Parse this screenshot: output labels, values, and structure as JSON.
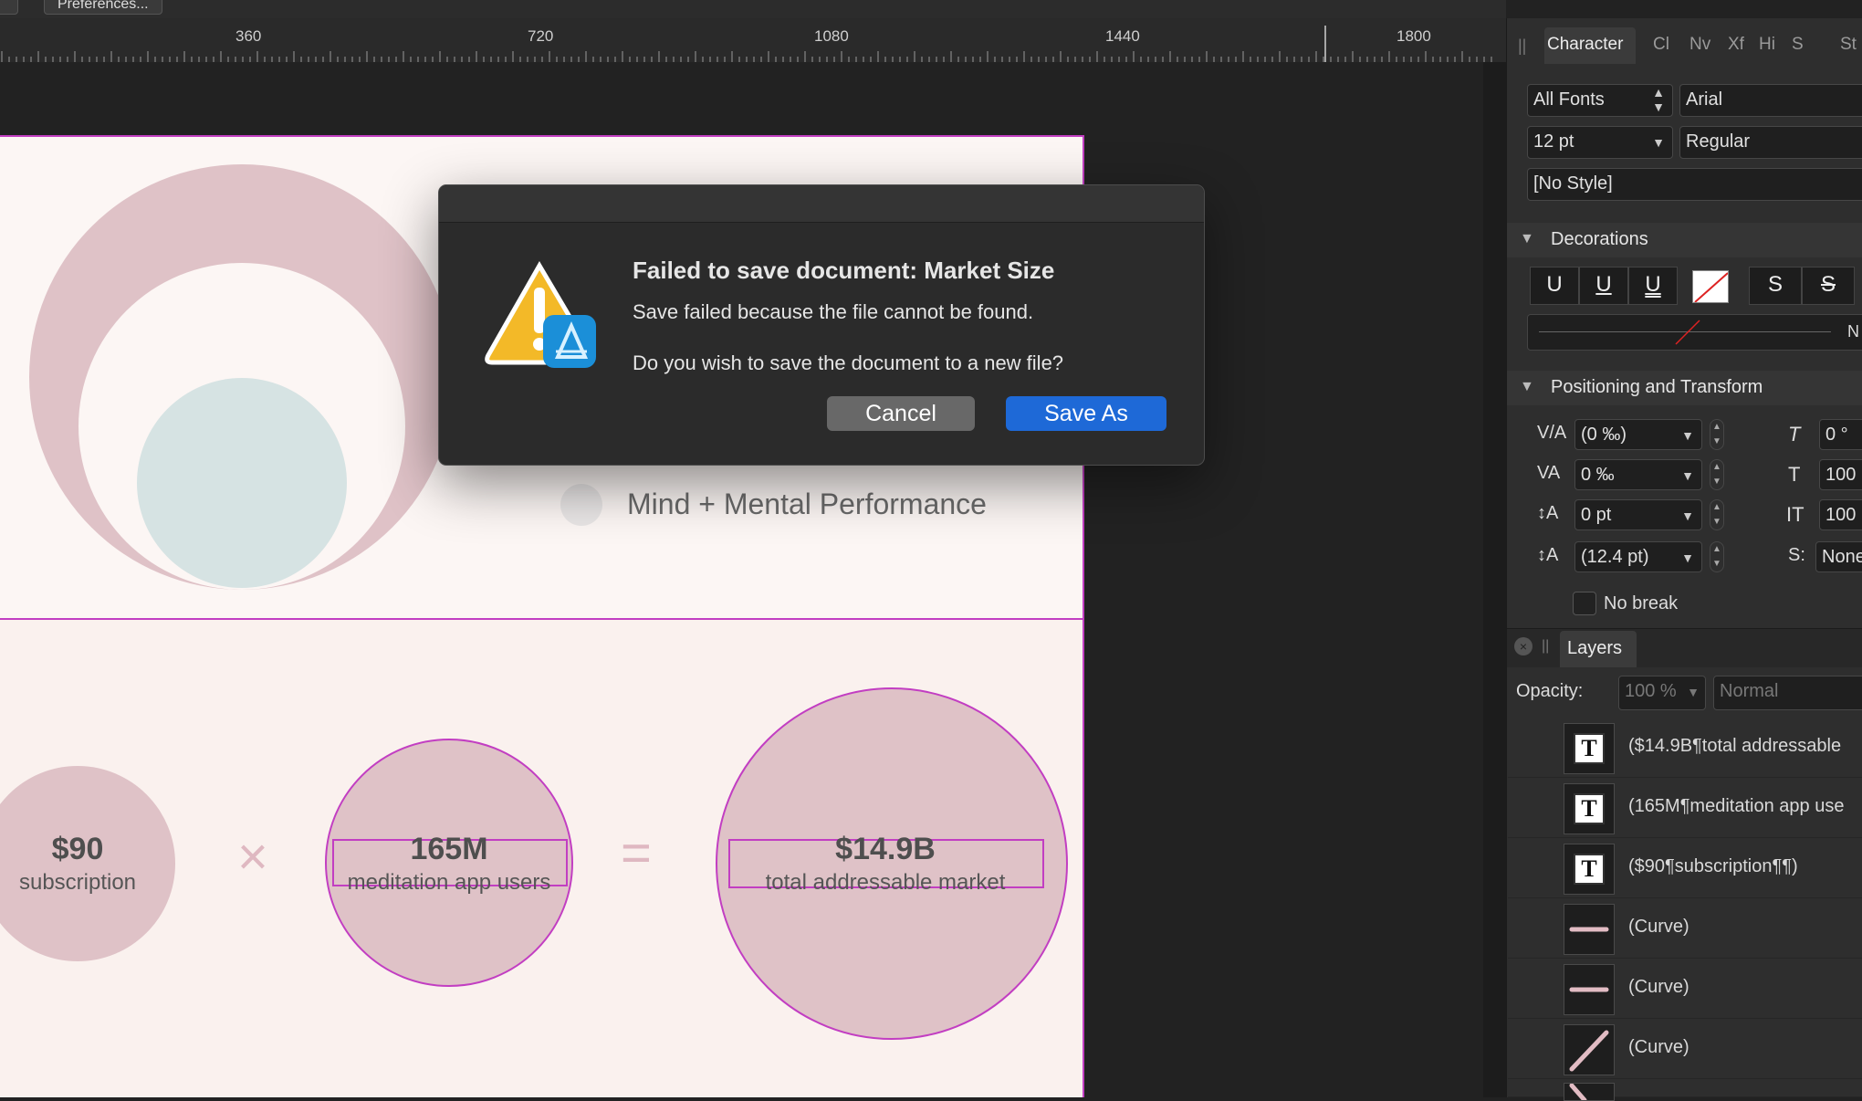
{
  "toolbar": {
    "preferences_label": "Preferences..."
  },
  "ruler": {
    "ticks": [
      "360",
      "720",
      "1080",
      "1440",
      "1800"
    ]
  },
  "canvas": {
    "legend_item": "Mind + Mental Performance",
    "stats": [
      {
        "value": "$90",
        "label": "subscription"
      },
      {
        "value": "165M",
        "label": "meditation app users"
      },
      {
        "value": "$14.9B",
        "label": "total addressable market"
      }
    ],
    "operators": {
      "times": "×",
      "equals": "="
    },
    "colors": {
      "pink": "#dfc2c7",
      "mint": "#d6e3e3",
      "page": "#fcf6f4",
      "selection": "#c23ec2"
    }
  },
  "dialog": {
    "title": "Failed to save document: Market Size",
    "message": "Save failed because the file cannot be found.",
    "question": "Do you wish to save the document to a new file?",
    "cancel_label": "Cancel",
    "save_as_label": "Save As"
  },
  "panel": {
    "tabs": [
      "Character",
      "Cl",
      "Nv",
      "Xf",
      "Hi",
      "S",
      "St"
    ],
    "font_collection": "All Fonts",
    "font_family": "Arial",
    "font_size": "12 pt",
    "font_style": "Regular",
    "paragraph_style": "[No Style]",
    "decorations": {
      "header": "Decorations",
      "buttons": [
        "U",
        "U",
        "U",
        "S",
        "S"
      ],
      "line_value": "N"
    },
    "positioning": {
      "header": "Positioning and Transform",
      "kerning": "(0 ‰)",
      "tracking": "0 ‰",
      "baseline": "0 pt",
      "leading": "(12.4 pt)",
      "shear": "0 °",
      "horizontal_scale": "100",
      "vertical_scale": "100",
      "style": "None"
    },
    "no_break_label": "No break",
    "layers": {
      "tab": "Layers",
      "opacity_label": "Opacity:",
      "opacity_value": "100 %",
      "blend_mode": "Normal",
      "items": [
        {
          "name": "($14.9B¶total addressable",
          "type": "text"
        },
        {
          "name": "(165M¶meditation app use",
          "type": "text"
        },
        {
          "name": "($90¶subscription¶¶)",
          "type": "text"
        },
        {
          "name": "(Curve)",
          "type": "curve-h"
        },
        {
          "name": "(Curve)",
          "type": "curve-h"
        },
        {
          "name": "(Curve)",
          "type": "curve-d"
        }
      ]
    }
  }
}
